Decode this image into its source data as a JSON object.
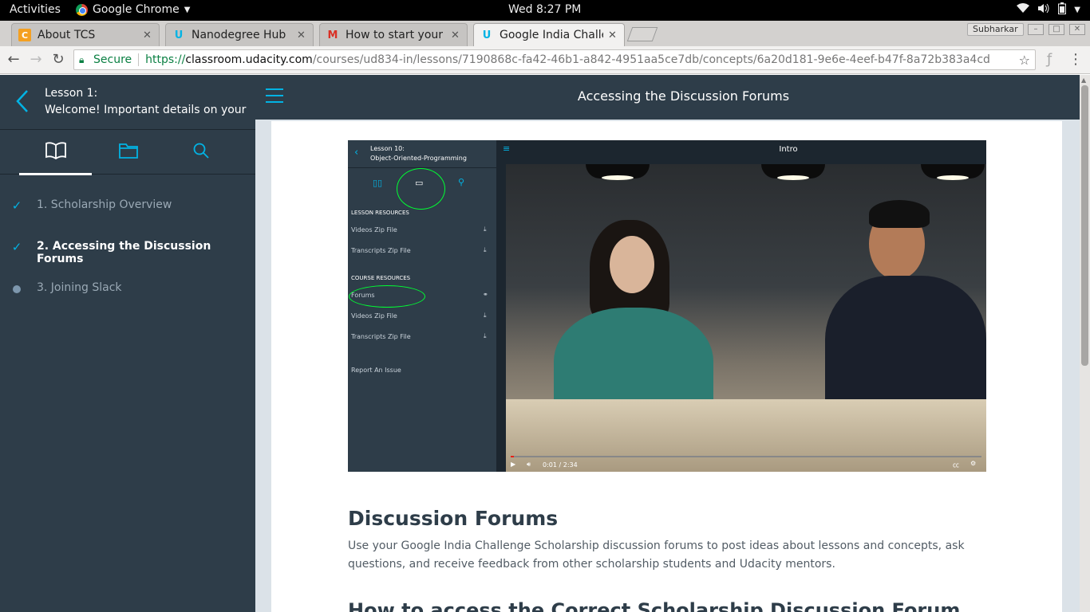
{
  "system": {
    "activities": "Activities",
    "app_menu": "Google Chrome",
    "clock": "Wed  8:27 PM"
  },
  "browser": {
    "tabs": [
      {
        "title": "About TCS",
        "favicon": "tcs-icon"
      },
      {
        "title": "Nanodegree Hub",
        "favicon": "udacity-icon"
      },
      {
        "title": "How to start your G",
        "favicon": "gmail-icon"
      },
      {
        "title": "Google India Challer",
        "favicon": "udacity-icon"
      }
    ],
    "profile": "Subharkar",
    "secure_label": "Secure",
    "url_scheme": "https://",
    "url_host": "classroom.udacity.com",
    "url_path": "/courses/ud834-in/lessons/7190868c-fa42-46b1-a842-4951aa5ce7db/concepts/6a20d181-9e6e-4eef-b47f-8a72b383a4cd"
  },
  "sidebar": {
    "lesson_label": "Lesson 1:",
    "lesson_title": "Welcome! Important details on your ...",
    "items": [
      {
        "label": "1. Scholarship Overview",
        "state": "completed"
      },
      {
        "label": "2. Accessing the Discussion Forums",
        "state": "current"
      },
      {
        "label": "3. Joining Slack",
        "state": "pending"
      }
    ]
  },
  "main": {
    "title": "Accessing the Discussion Forums",
    "video": {
      "lesson_label": "Lesson 10:",
      "lesson_title": "Object-Oriented-Programming",
      "player_title": "Intro",
      "lesson_resources_heading": "LESSON RESOURCES",
      "lesson_resources": [
        "Videos Zip File",
        "Transcripts Zip File"
      ],
      "course_resources_heading": "COURSE RESOURCES",
      "course_resources": [
        "Forums",
        "Videos Zip File",
        "Transcripts Zip File"
      ],
      "report_issue": "Report An Issue",
      "time": "0:01 / 2:34",
      "progress_fraction": 0.007
    },
    "heading": "Discussion Forums",
    "paragraph": "Use your Google India Challenge Scholarship discussion forums to post ideas about lessons and concepts, ask questions, and receive feedback from other scholarship students and Udacity mentors.",
    "next_heading": "How to access the Correct Scholarship Discussion Forum"
  },
  "colors": {
    "udacity_blue": "#02b3e4",
    "sidebar_bg": "#2e3d49",
    "secure_green": "#0b8043"
  }
}
